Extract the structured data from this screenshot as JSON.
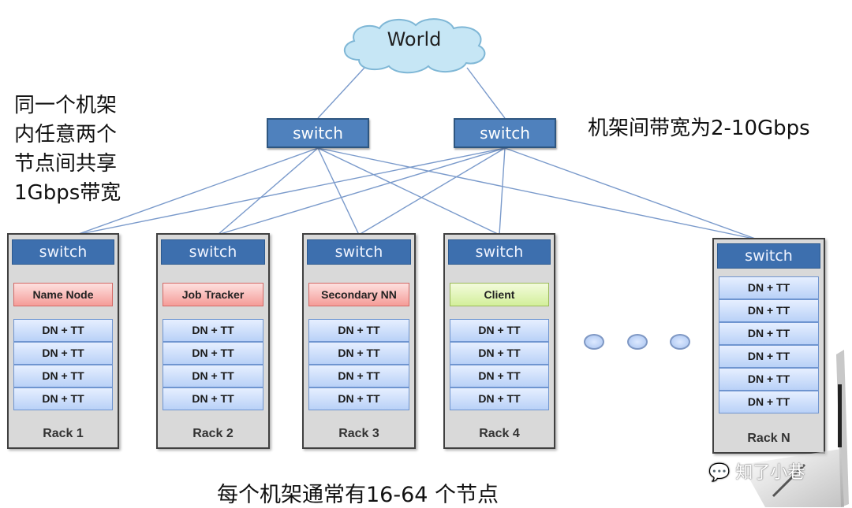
{
  "cloud": {
    "label": "World"
  },
  "core_switches": [
    {
      "label": "switch"
    },
    {
      "label": "switch"
    }
  ],
  "notes": {
    "left": "同一个机架\n内任意两个\n节点间共享\n1Gbps带宽",
    "right": "机架间带宽为2-10Gbps",
    "bottom": "每个机架通常有16-64 个节点"
  },
  "racks": [
    {
      "switch": "switch",
      "role": "Name Node",
      "role_type": "red",
      "nodes": [
        "DN + TT",
        "DN + TT",
        "DN + TT",
        "DN + TT"
      ],
      "label": "Rack 1"
    },
    {
      "switch": "switch",
      "role": "Job Tracker",
      "role_type": "red",
      "nodes": [
        "DN + TT",
        "DN + TT",
        "DN + TT",
        "DN + TT"
      ],
      "label": "Rack 2"
    },
    {
      "switch": "switch",
      "role": "Secondary NN",
      "role_type": "red",
      "nodes": [
        "DN + TT",
        "DN + TT",
        "DN + TT",
        "DN + TT"
      ],
      "label": "Rack 3"
    },
    {
      "switch": "switch",
      "role": "Client",
      "role_type": "green",
      "nodes": [
        "DN + TT",
        "DN + TT",
        "DN + TT",
        "DN + TT"
      ],
      "label": "Rack 4"
    },
    {
      "switch": "switch",
      "role": null,
      "role_type": null,
      "nodes": [
        "DN + TT",
        "DN + TT",
        "DN + TT",
        "DN + TT",
        "DN + TT",
        "DN + TT"
      ],
      "label": "Rack N"
    }
  ],
  "ellipsis_dots": 3,
  "watermark": "知了小巷",
  "colors": {
    "switch": "#4f81bd",
    "link": "#7a9acb",
    "rack_bg": "#d9d9d9",
    "cloud": "#c6e6f5"
  }
}
